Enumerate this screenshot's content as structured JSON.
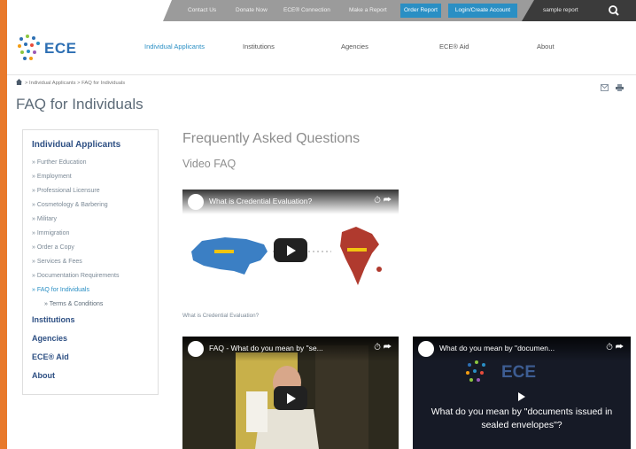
{
  "topbar": {
    "links": [
      "Contact Us",
      "Donate Now",
      "ECE® Connection",
      "Make a Report"
    ],
    "order_report": "Order Report",
    "login": "Login/Create Account",
    "search_placeholder": "sample report"
  },
  "logo": {
    "text": "ECE"
  },
  "nav": {
    "items": [
      "Individual Applicants",
      "Institutions",
      "Agencies",
      "ECE® Aid",
      "About"
    ],
    "active_index": 0
  },
  "breadcrumb": {
    "text": "> Individual Applicants > FAQ for Individuals"
  },
  "page_title": "FAQ for Individuals",
  "sidebar": {
    "heading": "Individual Applicants",
    "sub_items": [
      "» Further Education",
      "» Employment",
      "» Professional Licensure",
      "» Cosmetology & Barbering",
      "» Military",
      "» Immigration",
      "» Order a Copy",
      "» Services & Fees",
      "» Documentation Requirements",
      "» FAQ for Individuals"
    ],
    "nested_item": "» Terms & Conditions",
    "main_items": [
      "Institutions",
      "Agencies",
      "ECE® Aid",
      "About"
    ]
  },
  "content": {
    "heading": "Frequently Asked Questions",
    "subheading": "Video FAQ",
    "videos": [
      {
        "title": "What is Credential Evaluation?"
      },
      {
        "title": "FAQ - What do you mean by \"se..."
      },
      {
        "title": "What do you mean by \"documen..."
      }
    ],
    "caption": "What is Credential Evaluation?",
    "video3_overlay": "What do you mean by \"documents issued in sealed envelopes\"?",
    "video3_logo": "ECE"
  }
}
